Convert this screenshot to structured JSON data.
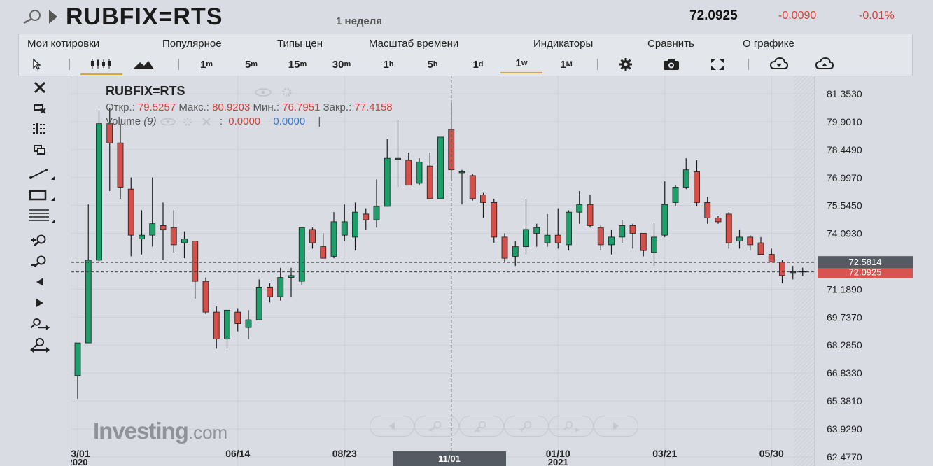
{
  "header": {
    "symbol": "RUBFIX=RTS",
    "interval": "1 неделя",
    "last_price": "72.0925",
    "change": "-0.0090",
    "change_pct": "-0.01%"
  },
  "menu": [
    "Мои котировки",
    "Популярное",
    "Типы цен",
    "Масштаб времени",
    "Индикаторы",
    "Сравнить",
    "О графике"
  ],
  "toolbar": {
    "timeframes": [
      {
        "main": "1",
        "sup": "m"
      },
      {
        "main": "5",
        "sup": "m"
      },
      {
        "main": "15",
        "sup": "m"
      },
      {
        "main": "30",
        "sup": "m"
      },
      {
        "main": "1",
        "sup": "h"
      },
      {
        "main": "5",
        "sup": "h"
      },
      {
        "main": "1",
        "sup": "d"
      },
      {
        "main": "1",
        "sup": "w"
      },
      {
        "main": "1",
        "sup": "M"
      }
    ],
    "active_timeframe": "1w",
    "icons": [
      "cursor-icon",
      "candlestick-icon",
      "mountain-icon",
      "gear-icon",
      "camera-icon",
      "fullscreen-icon",
      "download-icon",
      "upload-icon"
    ]
  },
  "left_tools": [
    "close-icon",
    "eraser-icon",
    "crosshair-icon",
    "copy-icon",
    "trendline-icon",
    "rectangle-icon",
    "fibonacci-icon",
    "zoom-in-icon",
    "zoom-out-icon",
    "scroll-left-icon",
    "scroll-right-icon",
    "zoom-right-icon",
    "zoom-fit-icon"
  ],
  "legend": {
    "title": "RUBFIX=RTS",
    "open_label": "Откр.:",
    "open": "79.5257",
    "high_label": "Макс.:",
    "high": "80.9203",
    "low_label": "Мин.:",
    "low": "76.7951",
    "close_label": "Закр.:",
    "close": "77.4158",
    "volume_label": "Volume",
    "volume_param": "(9)",
    "volume_val_1": "0.0000",
    "volume_val_2": "0.0000"
  },
  "logo": {
    "main": "Investing",
    "suffix": ".com"
  },
  "crosshair": {
    "date": "11/01",
    "price": "72.5814"
  },
  "colors": {
    "up": "#1e9e6a",
    "down": "#d4504a",
    "last_price_bg": "#d9534f",
    "crosshair_bg": "#555b62"
  },
  "chart_data": {
    "type": "candlestick",
    "title": "RUBFIX=RTS",
    "y_ticks": [
      "81.3530",
      "79.9010",
      "78.4490",
      "76.9970",
      "75.5450",
      "74.0930",
      "71.1890",
      "69.7370",
      "68.2850",
      "66.8330",
      "65.3810",
      "63.9290",
      "62.4770"
    ],
    "ylim": [
      62.0,
      82.3
    ],
    "x_labels": [
      {
        "label": "03/01",
        "sub": "2020",
        "index": 0
      },
      {
        "label": "06/14",
        "sub": "",
        "index": 15
      },
      {
        "label": "08/23",
        "sub": "",
        "index": 25
      },
      {
        "label": "01/10",
        "sub": "2021",
        "index": 45
      },
      {
        "label": "03/21",
        "sub": "",
        "index": 55
      },
      {
        "label": "05/30",
        "sub": "",
        "index": 65
      }
    ],
    "last_price": 72.0925,
    "crosshair_price": 72.5814,
    "crosshair_index": 35,
    "candles": [
      {
        "o": 66.7,
        "h": 68.3,
        "l": 65.5,
        "c": 68.4
      },
      {
        "o": 68.4,
        "h": 75.6,
        "l": 68.4,
        "c": 72.7
      },
      {
        "o": 72.7,
        "h": 80.5,
        "l": 72.6,
        "c": 79.8
      },
      {
        "o": 79.8,
        "h": 80.6,
        "l": 76.3,
        "c": 78.8
      },
      {
        "o": 78.8,
        "h": 79.8,
        "l": 75.9,
        "c": 76.5
      },
      {
        "o": 76.4,
        "h": 77.0,
        "l": 72.9,
        "c": 74.0
      },
      {
        "o": 73.8,
        "h": 75.3,
        "l": 73.0,
        "c": 74.0
      },
      {
        "o": 74.0,
        "h": 77.0,
        "l": 73.4,
        "c": 74.6
      },
      {
        "o": 74.5,
        "h": 75.7,
        "l": 72.7,
        "c": 74.3
      },
      {
        "o": 74.4,
        "h": 75.3,
        "l": 73.1,
        "c": 73.5
      },
      {
        "o": 73.6,
        "h": 74.2,
        "l": 72.8,
        "c": 73.8
      },
      {
        "o": 73.7,
        "h": 73.7,
        "l": 70.7,
        "c": 71.6
      },
      {
        "o": 71.6,
        "h": 71.8,
        "l": 69.9,
        "c": 70.0
      },
      {
        "o": 70.0,
        "h": 70.3,
        "l": 68.1,
        "c": 68.6
      },
      {
        "o": 68.6,
        "h": 70.1,
        "l": 68.1,
        "c": 70.1
      },
      {
        "o": 70.0,
        "h": 70.2,
        "l": 69.0,
        "c": 69.4
      },
      {
        "o": 69.2,
        "h": 70.1,
        "l": 68.6,
        "c": 69.6
      },
      {
        "o": 69.6,
        "h": 71.7,
        "l": 69.6,
        "c": 71.3
      },
      {
        "o": 71.3,
        "h": 71.5,
        "l": 70.5,
        "c": 70.8
      },
      {
        "o": 70.8,
        "h": 72.3,
        "l": 70.6,
        "c": 71.8
      },
      {
        "o": 71.8,
        "h": 72.3,
        "l": 70.8,
        "c": 71.9
      },
      {
        "o": 71.6,
        "h": 74.4,
        "l": 71.4,
        "c": 74.4
      },
      {
        "o": 74.3,
        "h": 74.4,
        "l": 73.3,
        "c": 73.6
      },
      {
        "o": 73.4,
        "h": 74.1,
        "l": 72.8,
        "c": 72.8
      },
      {
        "o": 72.9,
        "h": 75.2,
        "l": 72.8,
        "c": 74.7
      },
      {
        "o": 74.0,
        "h": 75.6,
        "l": 73.7,
        "c": 74.7
      },
      {
        "o": 73.9,
        "h": 75.7,
        "l": 73.2,
        "c": 75.2
      },
      {
        "o": 75.1,
        "h": 75.4,
        "l": 74.3,
        "c": 74.8
      },
      {
        "o": 74.8,
        "h": 76.9,
        "l": 74.4,
        "c": 75.5
      },
      {
        "o": 75.5,
        "h": 79.0,
        "l": 75.5,
        "c": 78.0
      },
      {
        "o": 78.0,
        "h": 80.0,
        "l": 76.5,
        "c": 78.0
      },
      {
        "o": 77.9,
        "h": 78.3,
        "l": 76.6,
        "c": 76.6
      },
      {
        "o": 76.7,
        "h": 78.0,
        "l": 76.6,
        "c": 77.8
      },
      {
        "o": 77.6,
        "h": 78.3,
        "l": 75.9,
        "c": 75.9
      },
      {
        "o": 75.9,
        "h": 79.1,
        "l": 75.9,
        "c": 79.1
      },
      {
        "o": 79.5,
        "h": 80.9,
        "l": 76.8,
        "c": 77.4
      },
      {
        "o": 77.3,
        "h": 77.4,
        "l": 75.6,
        "c": 77.3
      },
      {
        "o": 77.1,
        "h": 77.2,
        "l": 75.8,
        "c": 75.9
      },
      {
        "o": 76.1,
        "h": 76.2,
        "l": 74.9,
        "c": 75.7
      },
      {
        "o": 75.7,
        "h": 75.9,
        "l": 73.6,
        "c": 73.9
      },
      {
        "o": 73.9,
        "h": 74.1,
        "l": 72.6,
        "c": 72.8
      },
      {
        "o": 72.9,
        "h": 73.7,
        "l": 72.4,
        "c": 73.4
      },
      {
        "o": 73.4,
        "h": 75.9,
        "l": 73.0,
        "c": 74.3
      },
      {
        "o": 74.1,
        "h": 74.6,
        "l": 73.4,
        "c": 74.4
      },
      {
        "o": 73.6,
        "h": 75.1,
        "l": 73.4,
        "c": 74.0
      },
      {
        "o": 74.0,
        "h": 75.4,
        "l": 73.3,
        "c": 73.6
      },
      {
        "o": 73.5,
        "h": 75.3,
        "l": 73.2,
        "c": 75.2
      },
      {
        "o": 75.2,
        "h": 76.3,
        "l": 74.6,
        "c": 75.6
      },
      {
        "o": 75.6,
        "h": 76.1,
        "l": 74.4,
        "c": 74.5
      },
      {
        "o": 74.4,
        "h": 74.5,
        "l": 73.2,
        "c": 73.5
      },
      {
        "o": 73.5,
        "h": 74.3,
        "l": 73.0,
        "c": 73.9
      },
      {
        "o": 73.9,
        "h": 74.8,
        "l": 73.6,
        "c": 74.5
      },
      {
        "o": 74.5,
        "h": 74.6,
        "l": 73.3,
        "c": 74.1
      },
      {
        "o": 74.1,
        "h": 74.1,
        "l": 72.9,
        "c": 73.2
      },
      {
        "o": 73.1,
        "h": 74.6,
        "l": 72.4,
        "c": 73.9
      },
      {
        "o": 74.0,
        "h": 76.8,
        "l": 73.9,
        "c": 75.6
      },
      {
        "o": 75.7,
        "h": 76.6,
        "l": 75.5,
        "c": 76.5
      },
      {
        "o": 76.5,
        "h": 78.0,
        "l": 76.4,
        "c": 77.4
      },
      {
        "o": 77.3,
        "h": 77.9,
        "l": 75.5,
        "c": 75.7
      },
      {
        "o": 75.7,
        "h": 76.0,
        "l": 74.6,
        "c": 74.9
      },
      {
        "o": 74.9,
        "h": 75.0,
        "l": 74.6,
        "c": 74.7
      },
      {
        "o": 75.1,
        "h": 75.2,
        "l": 73.3,
        "c": 73.6
      },
      {
        "o": 73.7,
        "h": 74.3,
        "l": 73.3,
        "c": 73.9
      },
      {
        "o": 73.9,
        "h": 74.0,
        "l": 73.2,
        "c": 73.5
      },
      {
        "o": 73.6,
        "h": 73.9,
        "l": 73.0,
        "c": 73.0
      },
      {
        "o": 73.0,
        "h": 73.3,
        "l": 72.6,
        "c": 72.6
      },
      {
        "o": 72.6,
        "h": 72.7,
        "l": 71.5,
        "c": 71.9
      },
      {
        "o": 72.1,
        "h": 72.4,
        "l": 71.7,
        "c": 72.1
      }
    ]
  }
}
